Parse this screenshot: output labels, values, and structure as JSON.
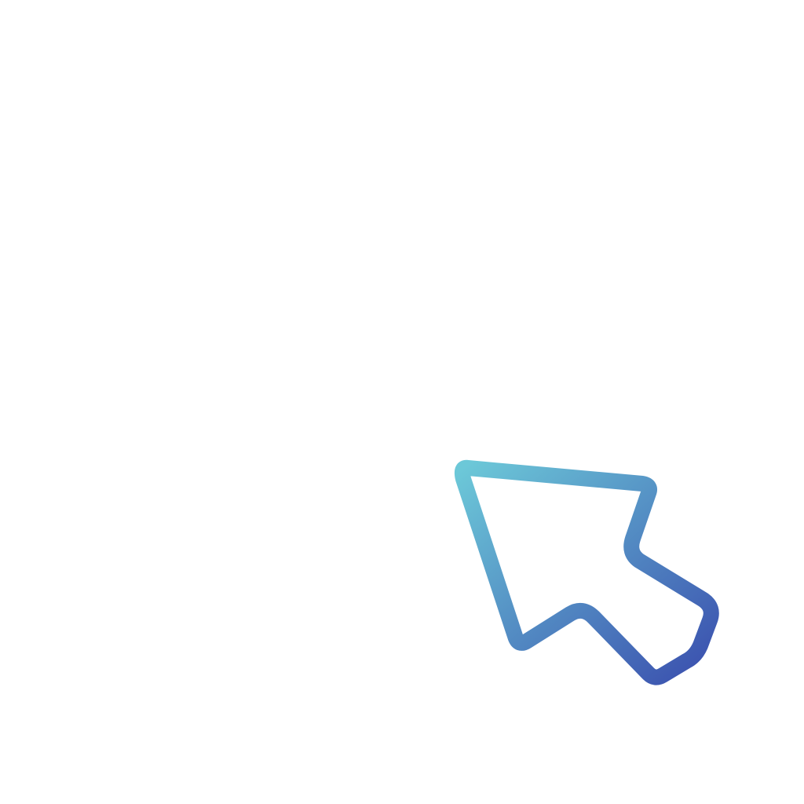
{
  "cursor": {
    "icon": "arrow-pointer-icon",
    "gradient_start": "#6cc8d8",
    "gradient_end": "#3a4fae",
    "fill": "#ffffff"
  },
  "background": "#ffffff"
}
